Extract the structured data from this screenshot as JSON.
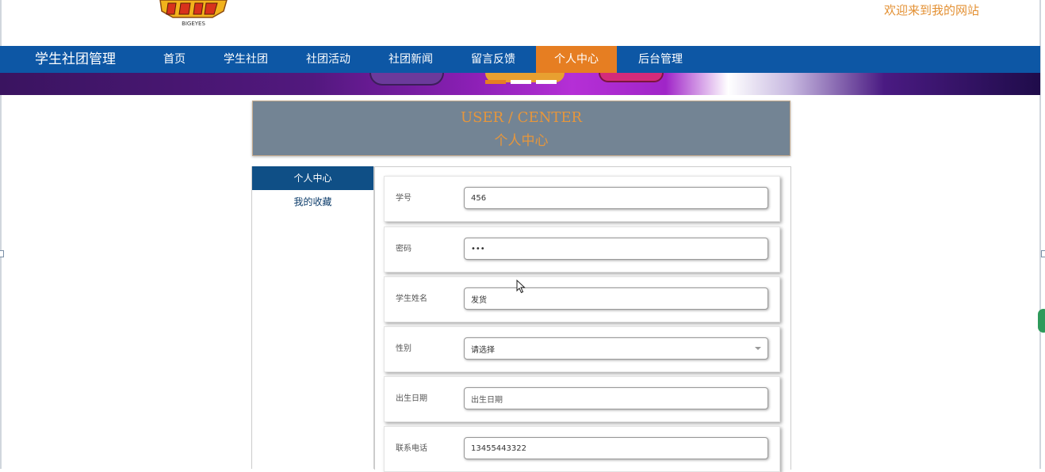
{
  "header": {
    "logo_text": "BIGEYES",
    "welcome": "欢迎来到我的网站"
  },
  "nav": {
    "brand": "学生社团管理",
    "items": [
      {
        "label": "首页",
        "active": false
      },
      {
        "label": "学生社团",
        "active": false
      },
      {
        "label": "社团活动",
        "active": false
      },
      {
        "label": "社团新闻",
        "active": false
      },
      {
        "label": "留言反馈",
        "active": false
      },
      {
        "label": "个人中心",
        "active": true
      },
      {
        "label": "后台管理",
        "active": false
      }
    ]
  },
  "banner": {
    "slide_count": 3,
    "active_slide": 1,
    "colors": {
      "active": "#e67e22",
      "inactive": "#ffffff"
    }
  },
  "page_title": {
    "en": "USER / CENTER",
    "cn": "个人中心"
  },
  "sidebar": {
    "items": [
      {
        "label": "个人中心",
        "active": true
      },
      {
        "label": "我的收藏",
        "active": false
      }
    ]
  },
  "form": {
    "fields": [
      {
        "label": "学号",
        "value": "456",
        "placeholder": ""
      },
      {
        "label": "密码",
        "value": "•••",
        "placeholder": ""
      },
      {
        "label": "学生姓名",
        "value": "发货",
        "placeholder": ""
      },
      {
        "label": "性别",
        "value": "请选择",
        "placeholder": ""
      },
      {
        "label": "出生日期",
        "value": "",
        "placeholder": "出生日期"
      },
      {
        "label": "联系电话",
        "value": "13455443322",
        "placeholder": ""
      }
    ]
  },
  "colors": {
    "nav_bg": "#0d57a5",
    "accent": "#e67e22",
    "sidebar_active": "#0f4f86",
    "title_bg": "#738494",
    "title_text": "#e6963c"
  }
}
